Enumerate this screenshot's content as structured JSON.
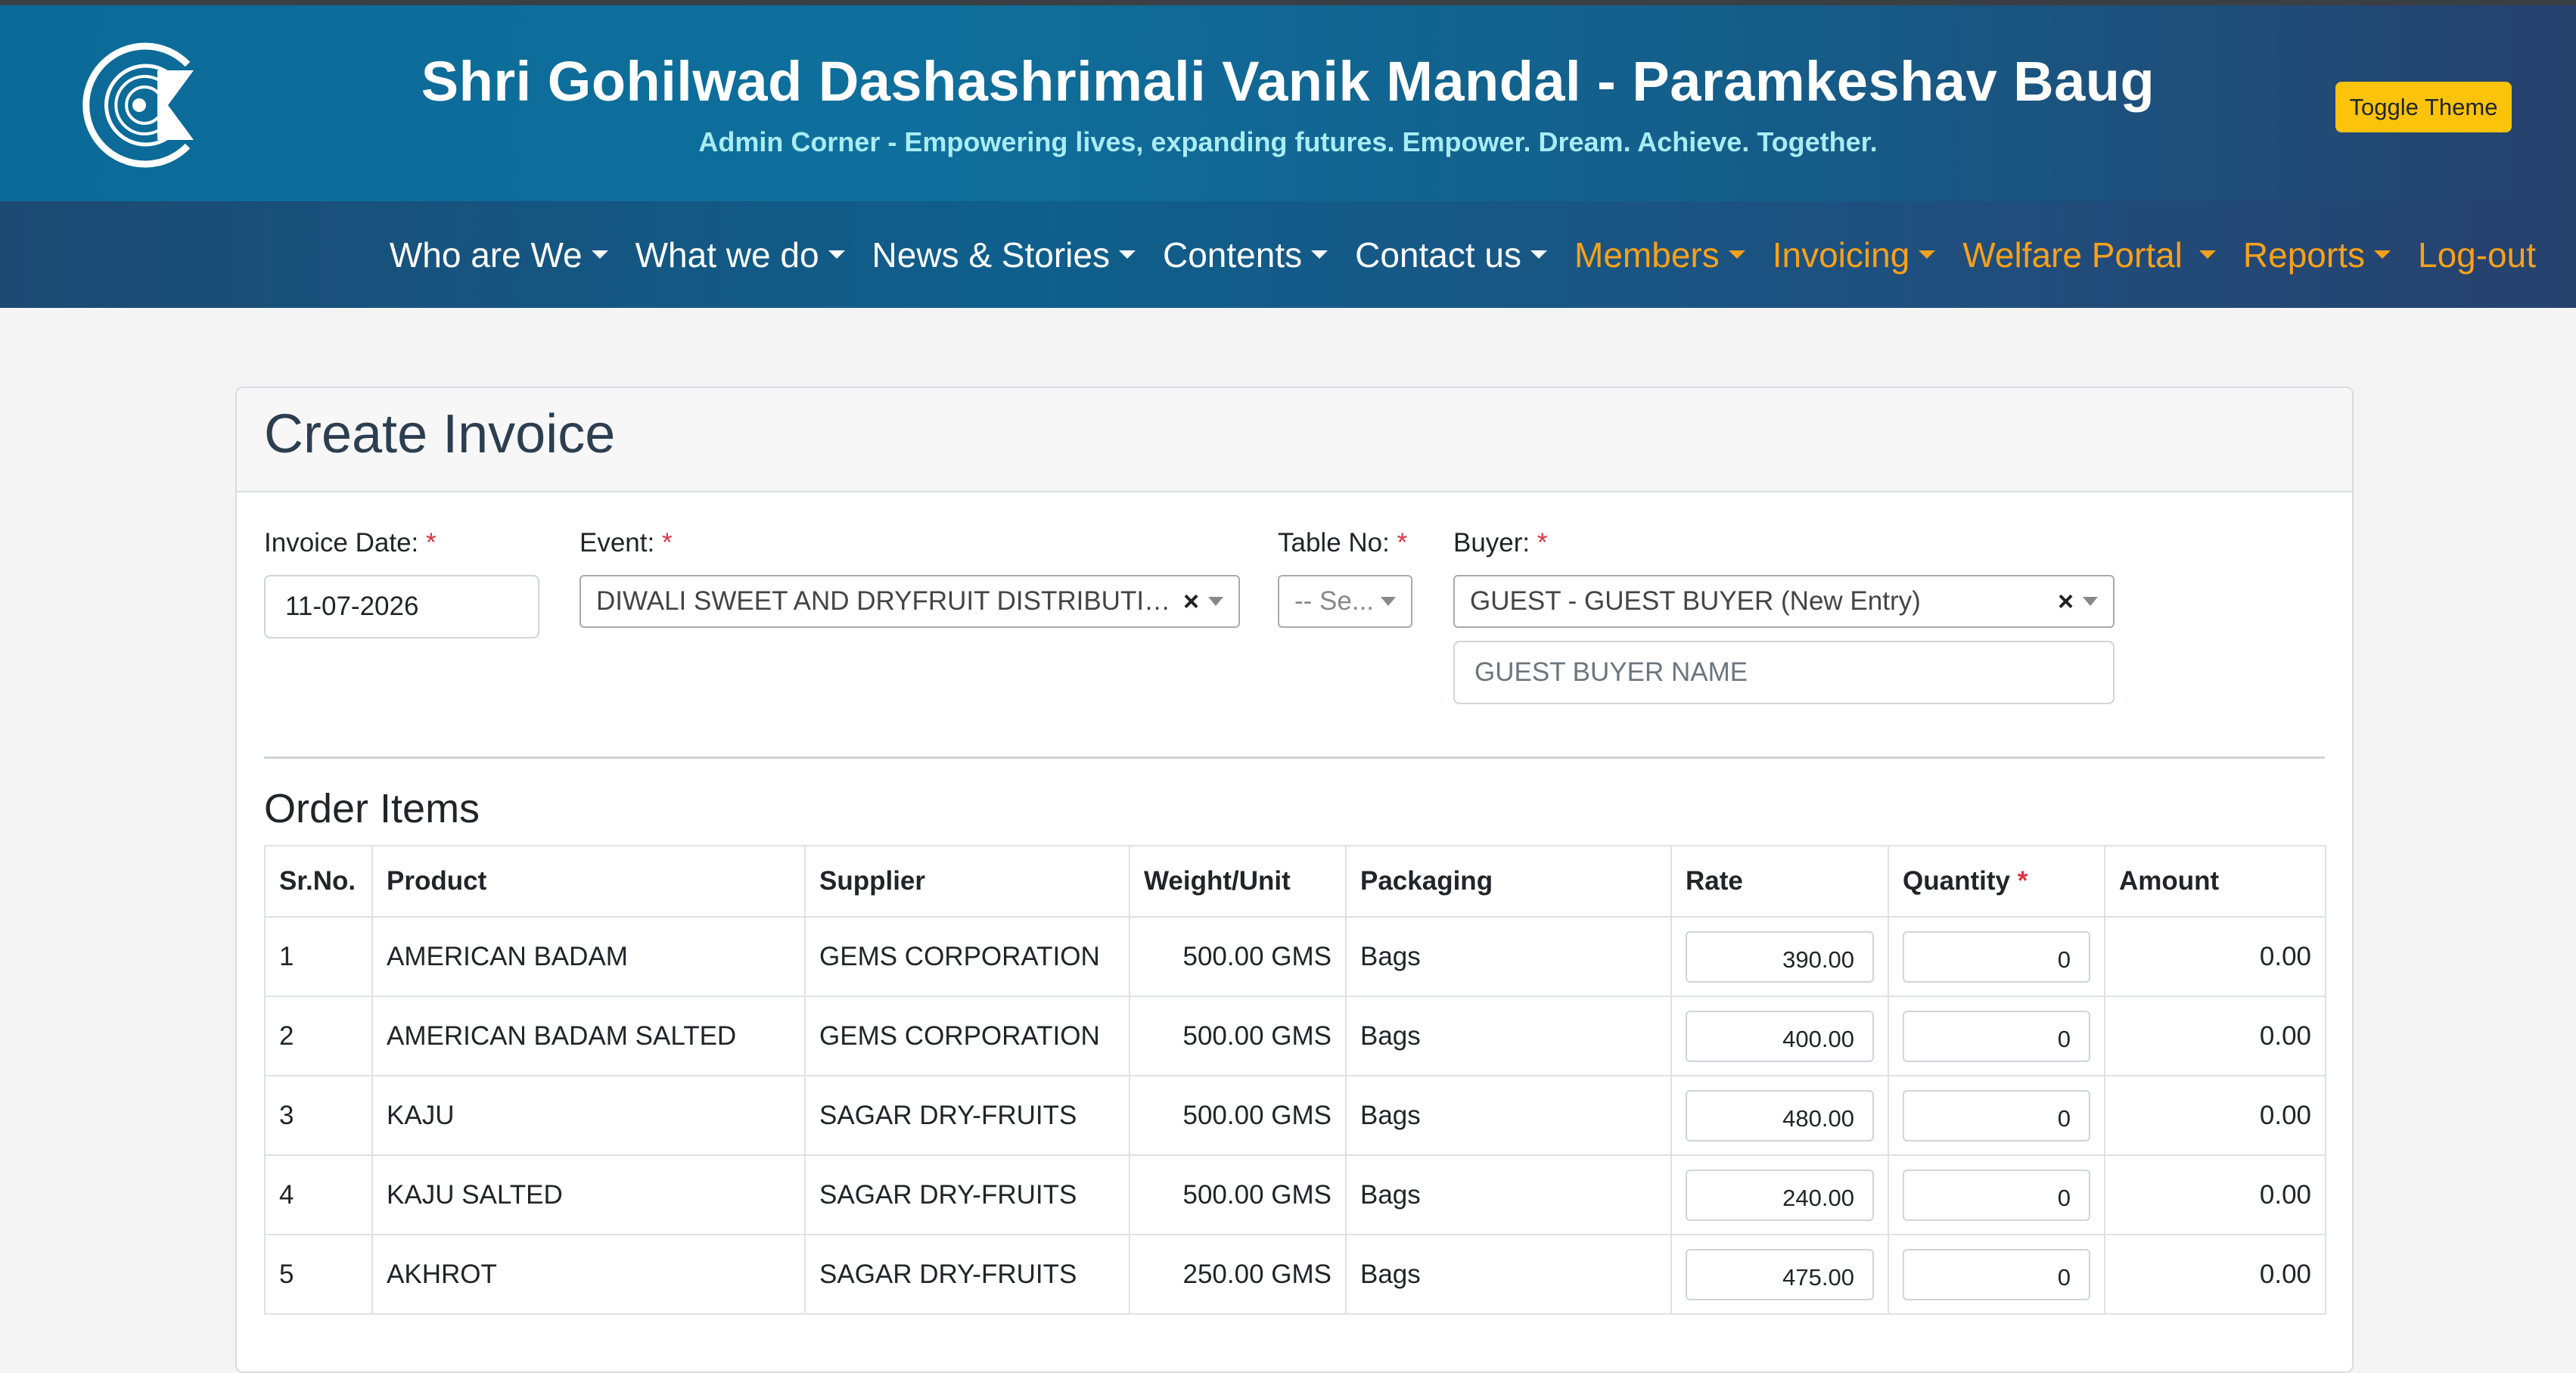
{
  "header": {
    "title": "Shri Gohilwad Dashashrimali Vanik Mandal - Paramkeshav Baug",
    "tagline": "Admin Corner - Empowering lives, expanding futures. Empower. Dream. Achieve. Together.",
    "toggle_label": "Toggle Theme",
    "logo_icon": "ck-logo-icon"
  },
  "nav": {
    "items": [
      {
        "label": "Who are We"
      },
      {
        "label": "What we do"
      },
      {
        "label": "News & Stories"
      },
      {
        "label": "Contents"
      },
      {
        "label": "Contact us"
      },
      {
        "label": "Members"
      },
      {
        "label": "Invoicing"
      },
      {
        "label": "Welfare Portal"
      },
      {
        "label": "Reports"
      },
      {
        "label": "Log-out"
      }
    ],
    "accent_color": "#f7a11a"
  },
  "form": {
    "title": "Create Invoice",
    "required_marker": "*",
    "invoice_date": {
      "label": "Invoice Date:",
      "value": "11-07-2026"
    },
    "event": {
      "label": "Event:",
      "value": "DIWALI SWEET AND DRYFRUIT DISTRIBUTIO..."
    },
    "table_no": {
      "label": "Table No:",
      "value": "-- Se..."
    },
    "buyer": {
      "label": "Buyer:",
      "value": "GUEST - GUEST BUYER (New Entry)",
      "name_placeholder": "GUEST BUYER NAME"
    },
    "clear_symbol": "×"
  },
  "order": {
    "title": "Order Items",
    "columns": [
      "Sr.No.",
      "Product",
      "Supplier",
      "Weight/Unit",
      "Packaging",
      "Rate",
      "Quantity",
      "Amount"
    ],
    "rows": [
      {
        "sr": "1",
        "product": "AMERICAN BADAM",
        "supplier": "GEMS CORPORATION",
        "weight": "500.00 GMS",
        "packaging": "Bags",
        "rate": "390.00",
        "quantity": "0",
        "amount": "0.00"
      },
      {
        "sr": "2",
        "product": "AMERICAN BADAM SALTED",
        "supplier": "GEMS CORPORATION",
        "weight": "500.00 GMS",
        "packaging": "Bags",
        "rate": "400.00",
        "quantity": "0",
        "amount": "0.00"
      },
      {
        "sr": "3",
        "product": "KAJU",
        "supplier": "SAGAR DRY-FRUITS",
        "weight": "500.00 GMS",
        "packaging": "Bags",
        "rate": "480.00",
        "quantity": "0",
        "amount": "0.00"
      },
      {
        "sr": "4",
        "product": "KAJU SALTED",
        "supplier": "SAGAR DRY-FRUITS",
        "weight": "500.00 GMS",
        "packaging": "Bags",
        "rate": "240.00",
        "quantity": "0",
        "amount": "0.00"
      },
      {
        "sr": "5",
        "product": "AKHROT",
        "supplier": "SAGAR DRY-FRUITS",
        "weight": "250.00 GMS",
        "packaging": "Bags",
        "rate": "475.00",
        "quantity": "0",
        "amount": "0.00"
      }
    ]
  }
}
